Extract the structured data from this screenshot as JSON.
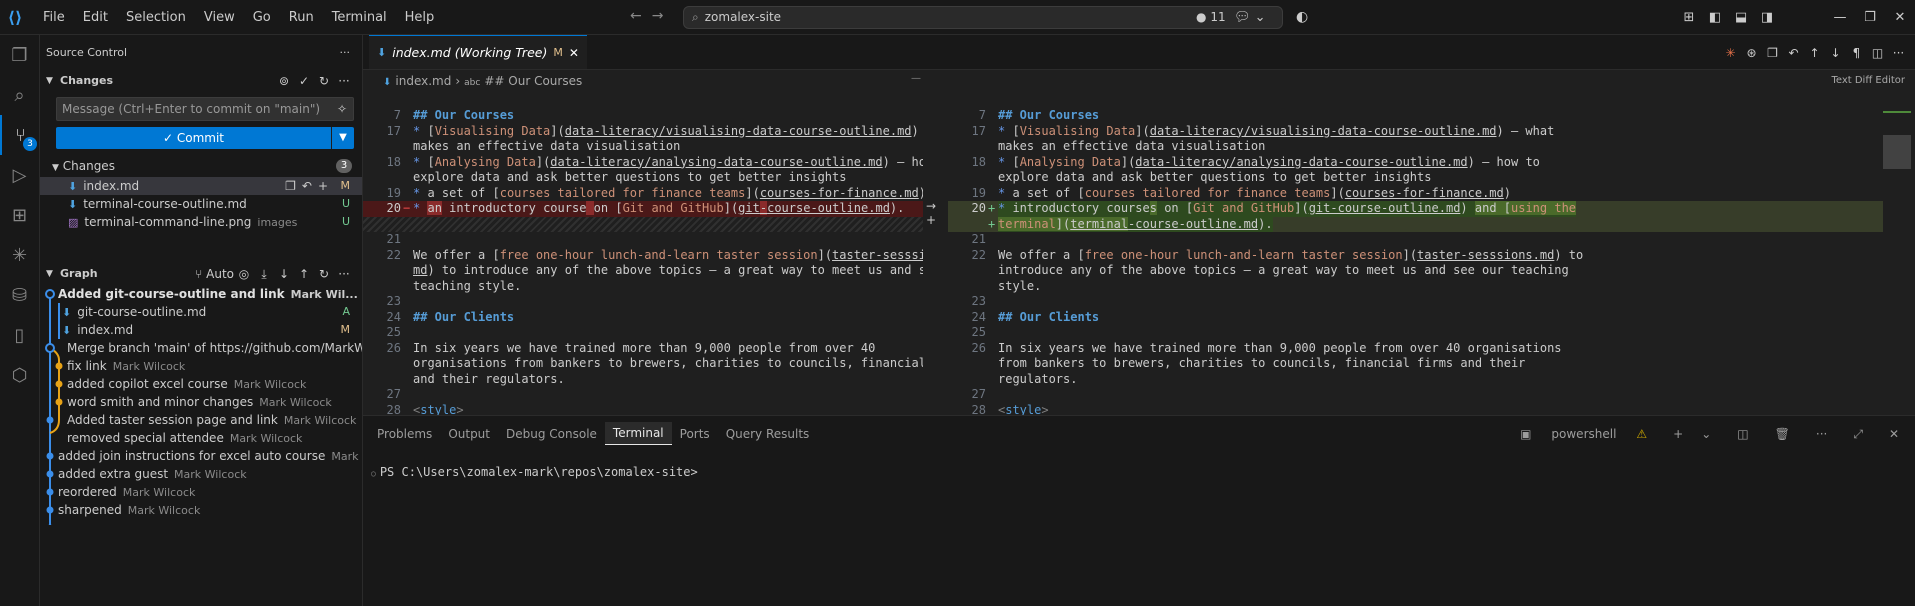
{
  "titlebar": {
    "menus": [
      "File",
      "Edit",
      "Selection",
      "View",
      "Go",
      "Run",
      "Terminal",
      "Help"
    ],
    "command_center": "zomalex-site",
    "problems_count": "11"
  },
  "activity_badge": "3",
  "sidebar": {
    "title": "Source Control",
    "changes_section": "Changes",
    "message_placeholder": "Message (Ctrl+Enter to commit on \"main\")",
    "commit_label": "Commit",
    "changes_group": "Changes",
    "changes_count": "3",
    "files": [
      {
        "name": "index.md",
        "dir": "",
        "status": "M"
      },
      {
        "name": "terminal-course-outline.md",
        "dir": "",
        "status": "U"
      },
      {
        "name": "terminal-command-line.png",
        "dir": "images",
        "status": "U"
      }
    ],
    "graph": {
      "title": "Graph",
      "auto_label": "Auto",
      "top_commit": "Added git-course-outline and link",
      "top_author": "Mark Wil...",
      "branch": "main",
      "top_files": [
        {
          "name": "git-course-outline.md",
          "status": "A"
        },
        {
          "name": "index.md",
          "status": "M"
        }
      ],
      "commits": [
        {
          "message": "Merge branch 'main' of https://github.com/MarkWilcock/z...",
          "author": ""
        },
        {
          "message": "fix link",
          "author": "Mark Wilcock"
        },
        {
          "message": "added copilot excel course",
          "author": "Mark Wilcock"
        },
        {
          "message": "word smith and minor changes",
          "author": "Mark Wilcock"
        },
        {
          "message": "Added taster session page and link",
          "author": "Mark Wilcock"
        },
        {
          "message": "removed special attendee",
          "author": "Mark Wilcock"
        },
        {
          "message": "added join instructions for excel auto course",
          "author": "Mark Wilcock"
        },
        {
          "message": "added extra guest",
          "author": "Mark Wilcock"
        },
        {
          "message": "reordered",
          "author": "Mark Wilcock"
        },
        {
          "message": "sharpened",
          "author": "Mark Wilcock"
        }
      ]
    }
  },
  "editor": {
    "tab_name": "index.md (Working Tree)",
    "tab_status": "M",
    "breadcrumb_file": "index.md",
    "breadcrumb_symbol": "## Our Courses",
    "diff_editor_label": "Text Diff Editor"
  },
  "panel": {
    "tabs": [
      "Problems",
      "Output",
      "Debug Console",
      "Terminal",
      "Ports",
      "Query Results"
    ],
    "active_tab": "Terminal",
    "shell": "powershell",
    "prompt": "PS C:\\Users\\zomalex-mark\\repos\\zomalex-site>"
  },
  "colors": {
    "accent": "#0078d4",
    "modified": "#e2c08d",
    "untracked": "#73c991",
    "deleted_bg": "#4b1818",
    "added_bg": "#373d29"
  }
}
